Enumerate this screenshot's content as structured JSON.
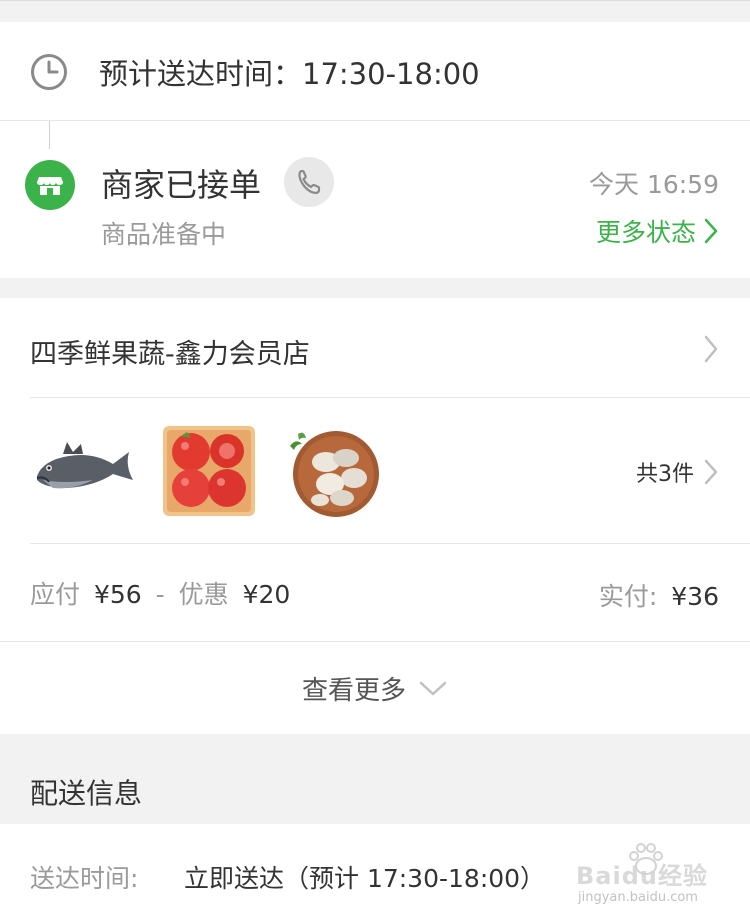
{
  "eta": {
    "label": "预计送达时间：17:30-18:00"
  },
  "status": {
    "title": "商家已接单",
    "subtitle": "商品准备中",
    "time": "今天 16:59",
    "more_label": "更多状态"
  },
  "store": {
    "name": "四季鲜果蔬-鑫力会员店"
  },
  "items": {
    "count_label": "共3件",
    "thumbs": [
      "fish",
      "tomatoes",
      "mushrooms"
    ]
  },
  "payment": {
    "due_label": "应付",
    "due_amount": "¥56",
    "discount_sep": "-",
    "discount_label": "优惠",
    "discount_amount": "¥20",
    "paid_label": "实付:",
    "paid_amount": "¥36"
  },
  "view_more": {
    "label": "查看更多"
  },
  "delivery": {
    "section_title": "配送信息",
    "time_label": "送达时间:",
    "time_value": "立即送达（预计 17:30-18:00）"
  },
  "watermark": {
    "brand": "Baidu经验",
    "url": "jingyan.baidu.com"
  },
  "colors": {
    "accent_green": "#3cb24a",
    "text_dark": "#333333",
    "text_gray": "#999999"
  },
  "icons": [
    "clock-icon",
    "store-icon",
    "phone-icon",
    "chevron-right-icon",
    "chevron-down-icon"
  ]
}
